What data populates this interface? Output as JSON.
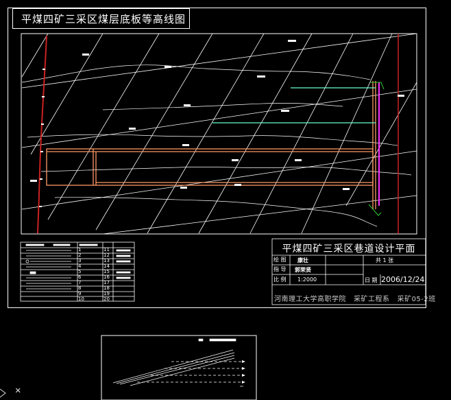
{
  "drawing": {
    "main_title": "平煤四矿三采区煤层底板等高线图",
    "title_block": {
      "title": "平煤四矿三采区巷道设计平面",
      "rows": [
        {
          "label": "绘 图",
          "value": "康壮"
        },
        {
          "label": "指 导",
          "value": "郭荣贤"
        },
        {
          "label": "比 例",
          "value": "1:2000"
        }
      ],
      "sheet": "共 1 张",
      "date_label": "日 期",
      "date": "2006/12/24",
      "school": "河南理工大学高职学院   采矿工程系   采矿05-2班"
    },
    "legend": {
      "numbers_a": [
        "1",
        "2",
        "3",
        "4",
        "5",
        "6",
        "7",
        "8",
        "9",
        "10"
      ],
      "numbers_b": [
        "11",
        "12",
        "13",
        "14",
        "15",
        "16",
        "17",
        "18",
        "19",
        "20"
      ]
    }
  },
  "colors": {
    "background": "#000000",
    "line": "#ffffff",
    "roadway_orange": "#ff9966",
    "boundary_red": "#cc2222",
    "roadway_cyan": "#66ffcc",
    "magenta": "#ff33ff",
    "green": "#33cc33"
  },
  "icons": {
    "ucs": "ucs-axis-icon",
    "cursor": "crosshair-icon"
  }
}
